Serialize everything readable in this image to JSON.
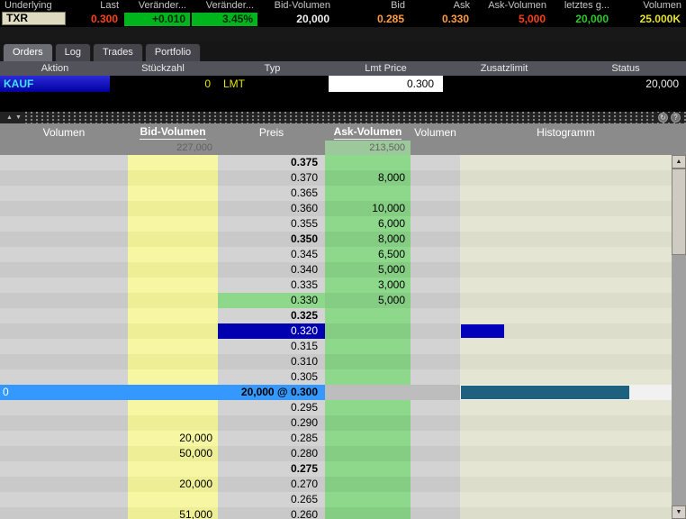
{
  "quote_bar": {
    "columns": [
      {
        "label": "Underlying",
        "value": "TXR",
        "align": "left",
        "boxed": true,
        "value_color": "#000000",
        "value_bg": "#DEDAC0"
      },
      {
        "label": "Last",
        "value": "0.300",
        "value_color": "#FF4019"
      },
      {
        "label": "Veränder...",
        "value": "+0.010",
        "value_color": "#012701",
        "value_bg": "#00B41E"
      },
      {
        "label": "Veränder...",
        "value": "3.45%",
        "value_color": "#012701",
        "value_bg": "#00B41E"
      },
      {
        "label": "Bid-Volumen",
        "value": "20,000",
        "value_color": "#F0F0F0"
      },
      {
        "label": "Bid",
        "value": "0.285",
        "value_color": "#FF9E3D"
      },
      {
        "label": "Ask",
        "value": "0.330",
        "value_color": "#FF9E3D"
      },
      {
        "label": "Ask-Volumen",
        "value": "5,000",
        "value_color": "#FF4019"
      },
      {
        "label": "letztes g...",
        "value": "20,000",
        "value_color": "#2ACC2A"
      },
      {
        "label": "Volumen",
        "value": "25.000K",
        "value_color": "#E3E329"
      }
    ]
  },
  "tabs": [
    {
      "label": "Orders",
      "active": true
    },
    {
      "label": "Log",
      "active": false
    },
    {
      "label": "Trades",
      "active": false
    },
    {
      "label": "Portfolio",
      "active": false
    }
  ],
  "order_panel": {
    "headers": [
      "Aktion",
      "Stückzahl",
      "Typ",
      "Lmt Price",
      "Zusatzlimit",
      "Status"
    ],
    "order": {
      "action": "KAUF",
      "quantity": "0",
      "type": "LMT",
      "lmt_price": "0.300",
      "zusatzlimit": "",
      "status": "20,000"
    }
  },
  "icons": {
    "up_arrow": "▲",
    "down_arrow": "▼",
    "refresh": "↻",
    "help": "?"
  },
  "ladder": {
    "columns": [
      "Volumen",
      "Bid-Volumen",
      "Preis",
      "Ask-Volumen",
      "Volumen",
      "Histogramm"
    ],
    "bid_total": "227,000",
    "ask_total": "213,500",
    "rows": [
      {
        "price": "0.375",
        "bold": true
      },
      {
        "price": "0.370",
        "ask": "8,000"
      },
      {
        "price": "0.365"
      },
      {
        "price": "0.360",
        "ask": "10,000"
      },
      {
        "price": "0.355",
        "ask": "6,000"
      },
      {
        "price": "0.350",
        "ask": "8,000",
        "bold": true
      },
      {
        "price": "0.345",
        "ask": "6,500"
      },
      {
        "price": "0.340",
        "ask": "5,000"
      },
      {
        "price": "0.335",
        "ask": "3,000"
      },
      {
        "price": "0.330",
        "ask": "5,000",
        "price_style": "best-ask"
      },
      {
        "price": "0.325",
        "bold": true
      },
      {
        "price": "0.320",
        "price_style": "order",
        "hist_width": 48,
        "hist_color": "#0000BB"
      },
      {
        "price": "0.315"
      },
      {
        "price": "0.310"
      },
      {
        "price": "0.305"
      },
      {
        "price": "20,000 @ 0.300",
        "row_style": "last-trade",
        "vol_left": "0",
        "bold": true,
        "hist_width": 187,
        "hist_color": "#1E617E"
      },
      {
        "price": "0.295"
      },
      {
        "price": "0.290"
      },
      {
        "price": "0.285",
        "bid": "20,000"
      },
      {
        "price": "0.280",
        "bid": "50,000"
      },
      {
        "price": "0.275",
        "bold": true
      },
      {
        "price": "0.270",
        "bid": "20,000"
      },
      {
        "price": "0.265"
      },
      {
        "price": "0.260",
        "bid": "51,000"
      }
    ]
  },
  "colors": {
    "bid_column": "#F7F7A3",
    "ask_column": "#8ED88C",
    "last_trade_row": "#3598FF",
    "order_price_cell": "#0000B0",
    "histogram_order_bar": "#0000BB",
    "histogram_trade_bar": "#1E617E",
    "quote_up_green": "#00B41E",
    "quote_down_red": "#FF4019",
    "bid_ask_orange": "#FF9E3D"
  }
}
